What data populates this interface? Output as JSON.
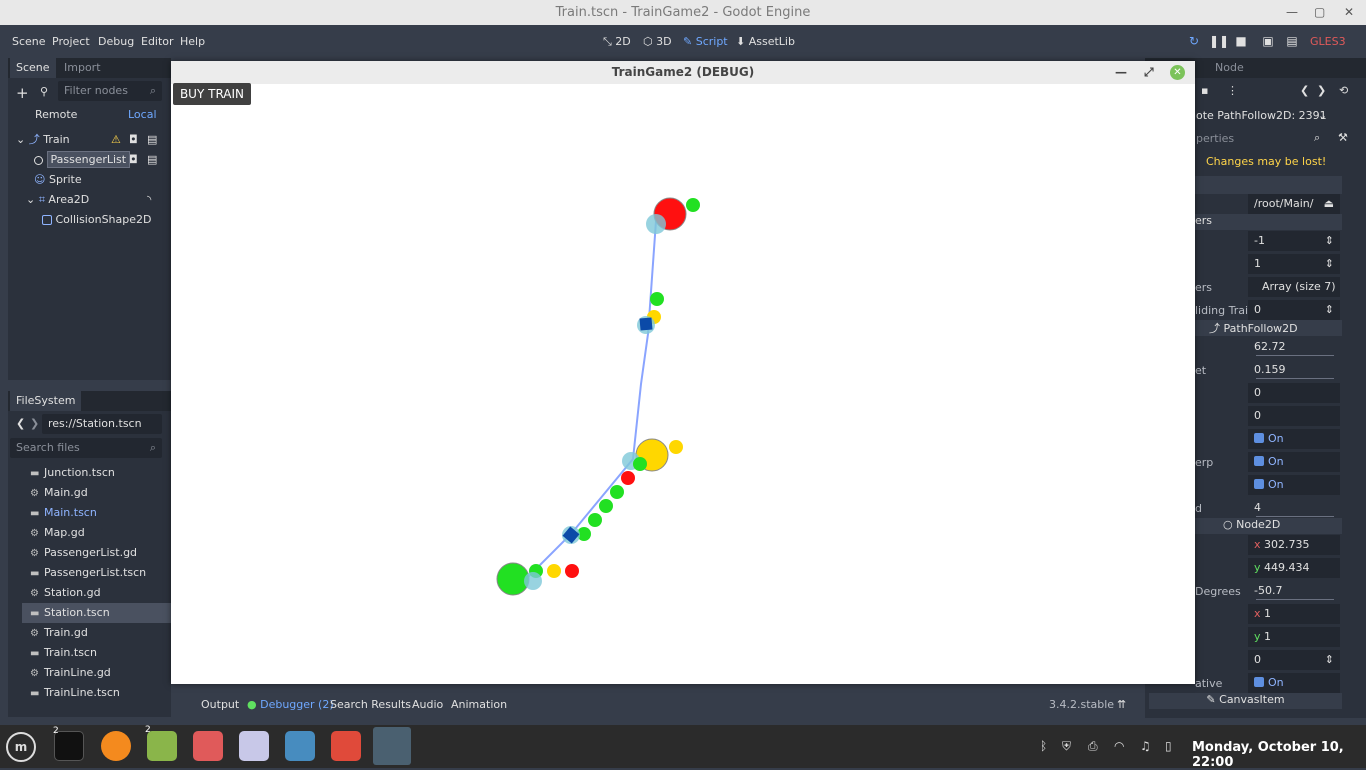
{
  "window": {
    "title": "Train.tscn - TrainGame2 - Godot Engine"
  },
  "menu": {
    "items": [
      "Scene",
      "Project",
      "Debug",
      "Editor",
      "Help"
    ]
  },
  "modes": {
    "d2": "2D",
    "d3": "3D",
    "script": "Script",
    "assetlib": "AssetLib"
  },
  "renderer": "GLES3",
  "scene_dock": {
    "tab_scene": "Scene",
    "tab_import": "Import",
    "filter_placeholder": "Filter nodes",
    "remote": "Remote",
    "local": "Local",
    "nodes": [
      "Train",
      "PassengerList",
      "Sprite",
      "Area2D",
      "CollisionShape2D"
    ]
  },
  "fs_dock": {
    "tab": "FileSystem",
    "path": "res://Station.tscn",
    "search_placeholder": "Search files",
    "files": [
      "Junction.tscn",
      "Main.gd",
      "Main.tscn",
      "Map.gd",
      "PassengerList.gd",
      "PassengerList.tscn",
      "Station.gd",
      "Station.tscn",
      "Train.gd",
      "Train.tscn",
      "TrainLine.gd",
      "TrainLine.tscn"
    ]
  },
  "inspector": {
    "tab_node": "Node",
    "object": "ote PathFollow2D: 2391",
    "filter_placeholder": "perties",
    "warning": "Changes may be lost!",
    "path": "/root/Main/",
    "section_label": "ers",
    "v_minus1": "-1",
    "v_1": "1",
    "passengers_label": "ers",
    "passengers": "Array (size 7)",
    "colliding_label": "liding Trai",
    "colliding": "0",
    "class_pathfollow": "PathFollow2D",
    "offset": "62.72",
    "unit_label": "et",
    "unit_offset": "0.159",
    "h_offset": "0",
    "v_offset": "0",
    "on": "On",
    "interp_label": "erp",
    "lookahead_label": "d",
    "lookahead": "4",
    "class_node2d": "Node2D",
    "pos_x_label": "x",
    "pos_x": "302.735",
    "pos_y_label": "y",
    "pos_y": "449.434",
    "deg_label": "Degrees",
    "rotation": "-50.7",
    "scale_x_label": "x",
    "scale_x": "1",
    "scale_y_label": "y",
    "scale_y": "1",
    "z_index": "0",
    "relative_label": "ative",
    "class_canvasitem": "CanvasItem"
  },
  "bottom": {
    "tabs": [
      "Output",
      "Debugger (2)",
      "Search Results",
      "Audio",
      "Animation"
    ],
    "version": "3.4.2.stable"
  },
  "game": {
    "title": "TrainGame2 (DEBUG)",
    "buy_button": "BUY TRAIN"
  },
  "taskbar": {
    "clock": "Monday, October 10, 22:00",
    "badge_terminal": "2",
    "badge_files": "2"
  },
  "colors": {
    "accent": "#6fa8ff",
    "green": "#22e022",
    "red": "#ff1010",
    "yellow": "#ffd700",
    "track": "#8aa4ff",
    "train": "#0b4aa8",
    "stop": "#7ec8d8"
  }
}
